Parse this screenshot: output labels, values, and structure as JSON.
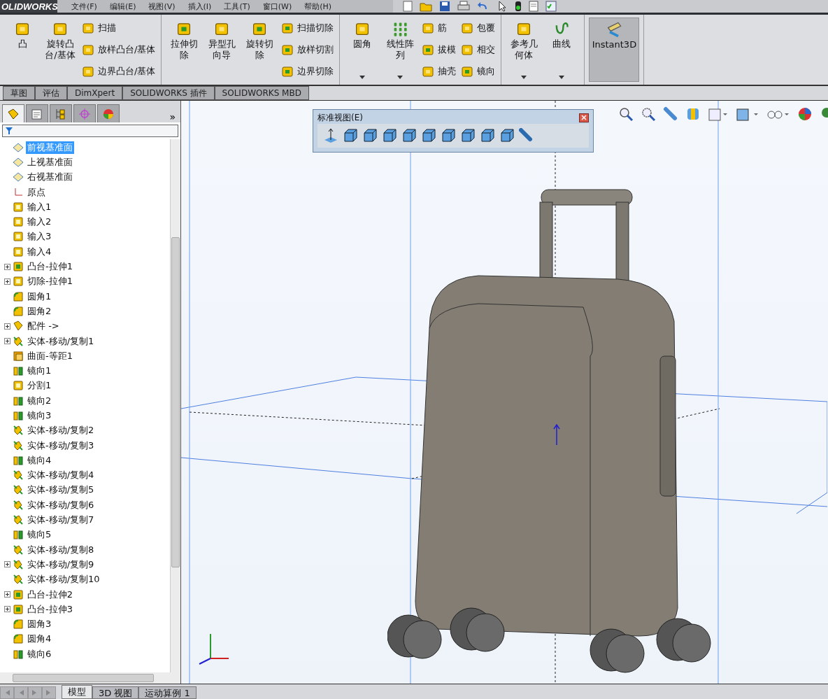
{
  "app": {
    "logo": "OLIDWORKS"
  },
  "menu": [
    "文件(F)",
    "编辑(E)",
    "视图(V)",
    "插入(I)",
    "工具(T)",
    "窗口(W)",
    "帮助(H)"
  ],
  "ribbon": {
    "groups": [
      {
        "big": [
          {
            "label": "凸",
            "kind": "solid"
          },
          {
            "label": "旋转凸台/基体",
            "kind": "solid"
          }
        ],
        "small": [
          [
            {
              "label": "扫描",
              "kind": "solid"
            },
            {
              "label": "放样凸台/基体",
              "kind": "solid"
            },
            {
              "label": "边界凸台/基体",
              "kind": "solid"
            }
          ]
        ]
      },
      {
        "big": [
          {
            "label": "拉伸切除",
            "kind": "cut"
          },
          {
            "label": "异型孔向导",
            "kind": "solid"
          },
          {
            "label": "旋转切除",
            "kind": "cut"
          }
        ],
        "small": [
          [
            {
              "label": "扫描切除",
              "kind": "cut"
            },
            {
              "label": "放样切割",
              "kind": "cut"
            },
            {
              "label": "边界切除",
              "kind": "cut"
            }
          ]
        ]
      },
      {
        "big": [
          {
            "label": "圆角",
            "kind": "solid",
            "dropdown": true
          },
          {
            "label": "线性阵列",
            "kind": "pattern",
            "dropdown": true
          }
        ],
        "small": [
          [
            {
              "label": "筋",
              "kind": "solid"
            },
            {
              "label": "拔模",
              "kind": "cut"
            },
            {
              "label": "抽壳",
              "kind": "solid"
            }
          ],
          [
            {
              "label": "包覆",
              "kind": "solid"
            },
            {
              "label": "相交",
              "kind": "solid"
            },
            {
              "label": "镜向",
              "kind": "cut"
            }
          ]
        ]
      },
      {
        "big": [
          {
            "label": "参考几何体",
            "kind": "solid",
            "dropdown": true
          },
          {
            "label": "曲线",
            "kind": "curve",
            "dropdown": true
          }
        ]
      },
      {
        "big": [
          {
            "label": "Instant3D",
            "kind": "ruler",
            "on": true
          }
        ]
      }
    ]
  },
  "command_tabs": [
    {
      "label": "草图",
      "selected": false
    },
    {
      "label": "评估",
      "selected": false
    },
    {
      "label": "DimXpert",
      "selected": false
    },
    {
      "label": "SOLIDWORKS 插件",
      "selected": false
    },
    {
      "label": "SOLIDWORKS MBD",
      "selected": false
    }
  ],
  "panel_tabs": [
    {
      "selected": true
    },
    {
      "selected": false
    },
    {
      "selected": false
    },
    {
      "selected": false
    },
    {
      "selected": false
    }
  ],
  "panel_more": "»",
  "tree": [
    {
      "label": "前视基准面",
      "kind": "plane",
      "selected": true,
      "expandable": false
    },
    {
      "label": "上视基准面",
      "kind": "plane",
      "selected": false,
      "expandable": false
    },
    {
      "label": "右视基准面",
      "kind": "plane",
      "selected": false,
      "expandable": false
    },
    {
      "label": "原点",
      "kind": "origin",
      "selected": false,
      "expandable": false
    },
    {
      "label": "输入1",
      "kind": "import",
      "selected": false,
      "expandable": false
    },
    {
      "label": "输入2",
      "kind": "import",
      "selected": false,
      "expandable": false
    },
    {
      "label": "输入3",
      "kind": "import",
      "selected": false,
      "expandable": false
    },
    {
      "label": "输入4",
      "kind": "import",
      "selected": false,
      "expandable": false
    },
    {
      "label": "凸台-拉伸1",
      "kind": "extrude",
      "selected": false,
      "expandable": true
    },
    {
      "label": "切除-拉伸1",
      "kind": "cut",
      "selected": false,
      "expandable": true
    },
    {
      "label": "圆角1",
      "kind": "fillet",
      "selected": false,
      "expandable": false
    },
    {
      "label": "圆角2",
      "kind": "fillet",
      "selected": false,
      "expandable": false
    },
    {
      "label": "配件 ->",
      "kind": "part",
      "selected": false,
      "expandable": true
    },
    {
      "label": "实体-移动/复制1",
      "kind": "move",
      "selected": false,
      "expandable": true
    },
    {
      "label": "曲面-等距1",
      "kind": "surface",
      "selected": false,
      "expandable": false
    },
    {
      "label": "镜向1",
      "kind": "mirror",
      "selected": false,
      "expandable": false
    },
    {
      "label": "分割1",
      "kind": "split",
      "selected": false,
      "expandable": false
    },
    {
      "label": "镜向2",
      "kind": "mirror",
      "selected": false,
      "expandable": false
    },
    {
      "label": "镜向3",
      "kind": "mirror",
      "selected": false,
      "expandable": false
    },
    {
      "label": "实体-移动/复制2",
      "kind": "move",
      "selected": false,
      "expandable": false
    },
    {
      "label": "实体-移动/复制3",
      "kind": "move",
      "selected": false,
      "expandable": false
    },
    {
      "label": "镜向4",
      "kind": "mirror",
      "selected": false,
      "expandable": false
    },
    {
      "label": "实体-移动/复制4",
      "kind": "move",
      "selected": false,
      "expandable": false
    },
    {
      "label": "实体-移动/复制5",
      "kind": "move",
      "selected": false,
      "expandable": false
    },
    {
      "label": "实体-移动/复制6",
      "kind": "move",
      "selected": false,
      "expandable": false
    },
    {
      "label": "实体-移动/复制7",
      "kind": "move",
      "selected": false,
      "expandable": false
    },
    {
      "label": "镜向5",
      "kind": "mirror",
      "selected": false,
      "expandable": false
    },
    {
      "label": "实体-移动/复制8",
      "kind": "move",
      "selected": false,
      "expandable": false
    },
    {
      "label": "实体-移动/复制9",
      "kind": "move",
      "selected": false,
      "expandable": true
    },
    {
      "label": "实体-移动/复制10",
      "kind": "move",
      "selected": false,
      "expandable": false
    },
    {
      "label": "凸台-拉伸2",
      "kind": "extrude",
      "selected": false,
      "expandable": true
    },
    {
      "label": "凸台-拉伸3",
      "kind": "extrude",
      "selected": false,
      "expandable": true
    },
    {
      "label": "圆角3",
      "kind": "fillet",
      "selected": false,
      "expandable": false
    },
    {
      "label": "圆角4",
      "kind": "fillet",
      "selected": false,
      "expandable": false
    },
    {
      "label": "镜向6",
      "kind": "mirror",
      "selected": false,
      "expandable": false
    }
  ],
  "view_toolbar": {
    "title": "标准视图(E)"
  },
  "bottom_tabs": [
    {
      "label": "模型",
      "selected": true
    },
    {
      "label": "3D 视图",
      "selected": false
    },
    {
      "label": "运动算例 1",
      "selected": false
    }
  ]
}
